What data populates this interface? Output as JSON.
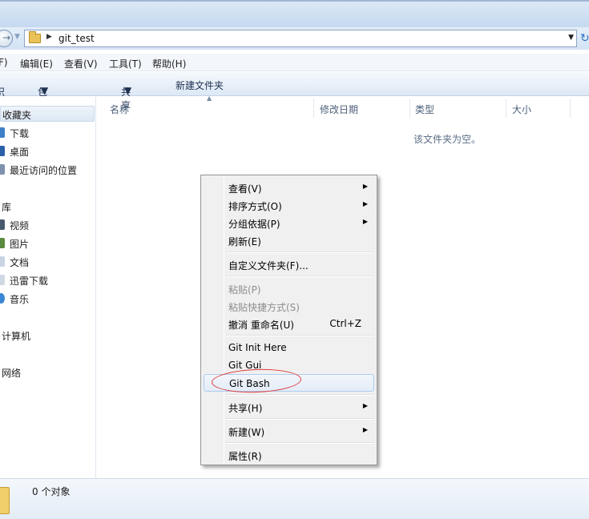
{
  "address": {
    "path": "git_test"
  },
  "menu": [
    "F)",
    "编辑(E)",
    "查看(V)",
    "工具(T)",
    "帮助(H)"
  ],
  "toolbar": {
    "organize": "织",
    "include_library": "包含到库中",
    "share": "共享",
    "new_folder": "新建文件夹"
  },
  "nav": {
    "favorites": "收藏夹",
    "downloads": "下载",
    "desktop": "桌面",
    "recent": "最近访问的位置",
    "libraries": "库",
    "videos": "视频",
    "pictures": "图片",
    "documents": "文档",
    "thunder": "迅雷下载",
    "music": "音乐",
    "computer": "计算机",
    "network": "网络"
  },
  "columns": {
    "name": "名称",
    "modified": "修改日期",
    "type": "类型",
    "size": "大小"
  },
  "empty_message": "该文件夹为空。",
  "status": {
    "count": "0 个对象"
  },
  "context_menu": {
    "view": "查看(V)",
    "sort": "排序方式(O)",
    "group": "分组依据(P)",
    "refresh": "刷新(E)",
    "customize": "自定义文件夹(F)...",
    "paste": "粘贴(P)",
    "paste_shortcut": "粘贴快捷方式(S)",
    "undo": "撤消 重命名(U)",
    "undo_shortcut": "Ctrl+Z",
    "git_init": "Git Init Here",
    "git_gui": "Git Gui",
    "git_bash": "Git Bash",
    "share": "共享(H)",
    "new": "新建(W)",
    "properties": "属性(R)"
  },
  "colors": {
    "annotation": "#e03a3a",
    "highlight_border": "#aecbf0",
    "folder": "#e9c357"
  }
}
